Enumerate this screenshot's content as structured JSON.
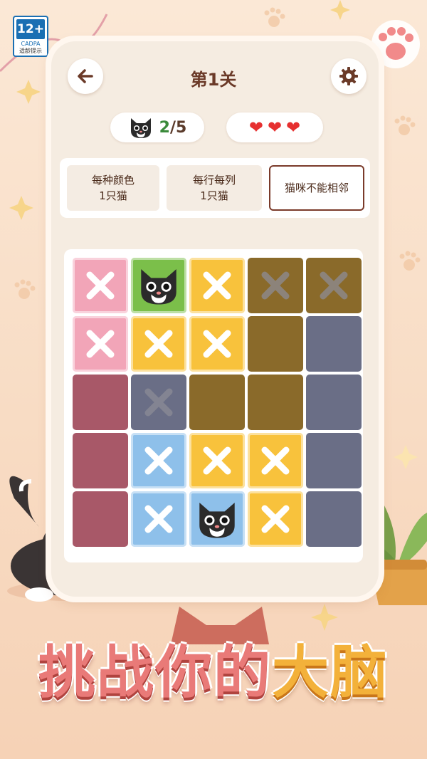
{
  "rating": {
    "age": "12+",
    "org": "CADPA",
    "tip": "适龄提示"
  },
  "header": {
    "title": "第1关",
    "back_icon": "back-arrow-icon",
    "settings_icon": "gear-icon"
  },
  "status": {
    "cats_found": "2",
    "cats_total": "/5",
    "lives": 3
  },
  "rules": [
    {
      "line1": "每种颜色",
      "line2": "1只猫",
      "selected": false
    },
    {
      "line1": "每行每列",
      "line2": "1只猫",
      "selected": false
    },
    {
      "line1": "猫咪不能相邻",
      "line2": "",
      "selected": true
    }
  ],
  "board": {
    "colors": {
      "P": "#a85868",
      "G": "#7bbf4a",
      "Y": "#f6b52c",
      "O": "#8a6a2a",
      "S": "#6a6e86",
      "B": "#7fb3e2"
    },
    "grid": [
      [
        "P",
        "G",
        "Y",
        "O",
        "O"
      ],
      [
        "P",
        "Y",
        "Y",
        "O",
        "S"
      ],
      [
        "P",
        "S",
        "O",
        "O",
        "S"
      ],
      [
        "P",
        "B",
        "Y",
        "Y",
        "S"
      ],
      [
        "P",
        "B",
        "B",
        "Y",
        "S"
      ]
    ],
    "marks": [
      [
        "x",
        "cat",
        "x",
        "x-dim",
        "x-dim"
      ],
      [
        "x",
        "x",
        "x",
        "",
        ""
      ],
      [
        "",
        "x-dim",
        "",
        "",
        ""
      ],
      [
        "",
        "x",
        "x",
        "x",
        ""
      ],
      [
        "",
        "x",
        "cat",
        "x",
        ""
      ]
    ],
    "highlight": [
      [
        1,
        1,
        1,
        0,
        0
      ],
      [
        1,
        1,
        1,
        0,
        0
      ],
      [
        0,
        0,
        0,
        0,
        0
      ],
      [
        0,
        1,
        1,
        1,
        0
      ],
      [
        0,
        1,
        1,
        1,
        0
      ]
    ]
  },
  "headline": {
    "part1": "挑战你的",
    "part2": "大脑"
  }
}
